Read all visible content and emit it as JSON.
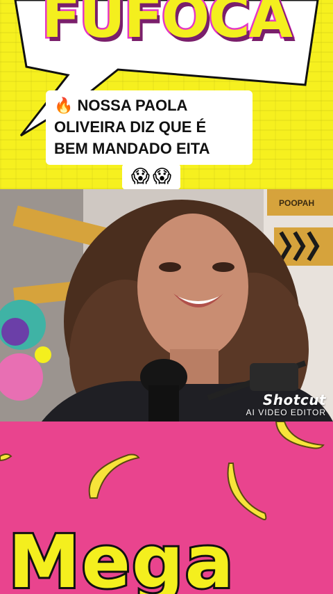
{
  "header": {
    "brand_title": "FUFOCA"
  },
  "caption": {
    "lines": [
      "🔥 NOSSA PAOLA",
      "OLIVEIRA DIZ QUE É",
      "BEM MANDADO EITA"
    ],
    "emojis": [
      "😱",
      "😱"
    ]
  },
  "video": {
    "signs": [
      "POOPAH"
    ],
    "watermark": {
      "logo": "Shotcut",
      "subtitle": "AI VIDEO EDITOR"
    }
  },
  "footer": {
    "brand_title": "Mega"
  },
  "colors": {
    "top_background": "#f6f01f",
    "title_stroke": "#e437c6",
    "bottom_background": "#e9448e",
    "banana": "#f7e43a"
  }
}
